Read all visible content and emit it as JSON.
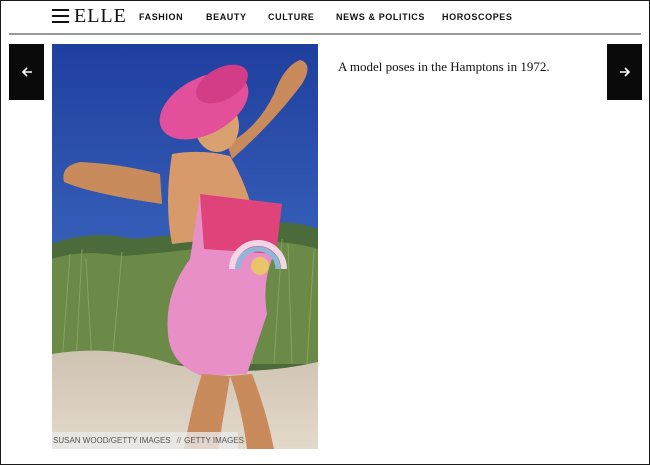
{
  "header": {
    "logo": "ELLE",
    "nav": [
      {
        "label": "FASHION"
      },
      {
        "label": "BEAUTY"
      },
      {
        "label": "CULTURE"
      },
      {
        "label": "NEWS & POLITICS"
      },
      {
        "label": "HOROSCOPES"
      }
    ]
  },
  "gallery": {
    "prev_icon": "arrow-left-icon",
    "next_icon": "arrow-right-icon",
    "caption": "A model poses in the Hamptons in 1972.",
    "photo": {
      "credit_photographer": "SUSAN WOOD/GETTY IMAGES",
      "credit_separator": "//",
      "credit_agency": "GETTY IMAGES"
    }
  },
  "colors": {
    "header_text": "#111111",
    "arrow_bg": "#0a0a0a",
    "sky": "#2d4fae",
    "hat": "#e34f9a",
    "swimsuit": "#e98fc8"
  }
}
